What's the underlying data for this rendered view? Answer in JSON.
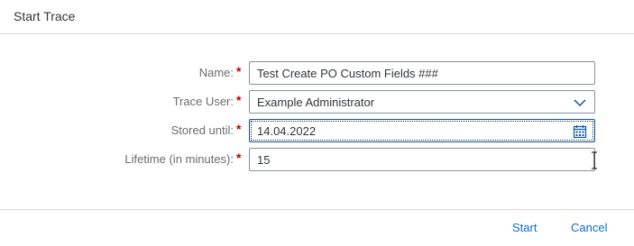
{
  "dialog": {
    "title": "Start Trace"
  },
  "form": {
    "name": {
      "label": "Name:",
      "required": "*",
      "value": "Test Create PO Custom Fields ###"
    },
    "trace_user": {
      "label": "Trace User:",
      "required": "*",
      "value": "Example Administrator",
      "icon": "chevron-down-icon"
    },
    "stored_until": {
      "label": "Stored until:",
      "required": "*",
      "value": "14.04.2022",
      "icon": "calendar-icon"
    },
    "lifetime": {
      "label": "Lifetime (in minutes):",
      "required": "*",
      "value": "15"
    }
  },
  "footer": {
    "start_label": "Start",
    "cancel_label": "Cancel"
  },
  "colors": {
    "accent": "#0a6ed1",
    "required": "#bb0000",
    "label": "#6a6d70"
  }
}
